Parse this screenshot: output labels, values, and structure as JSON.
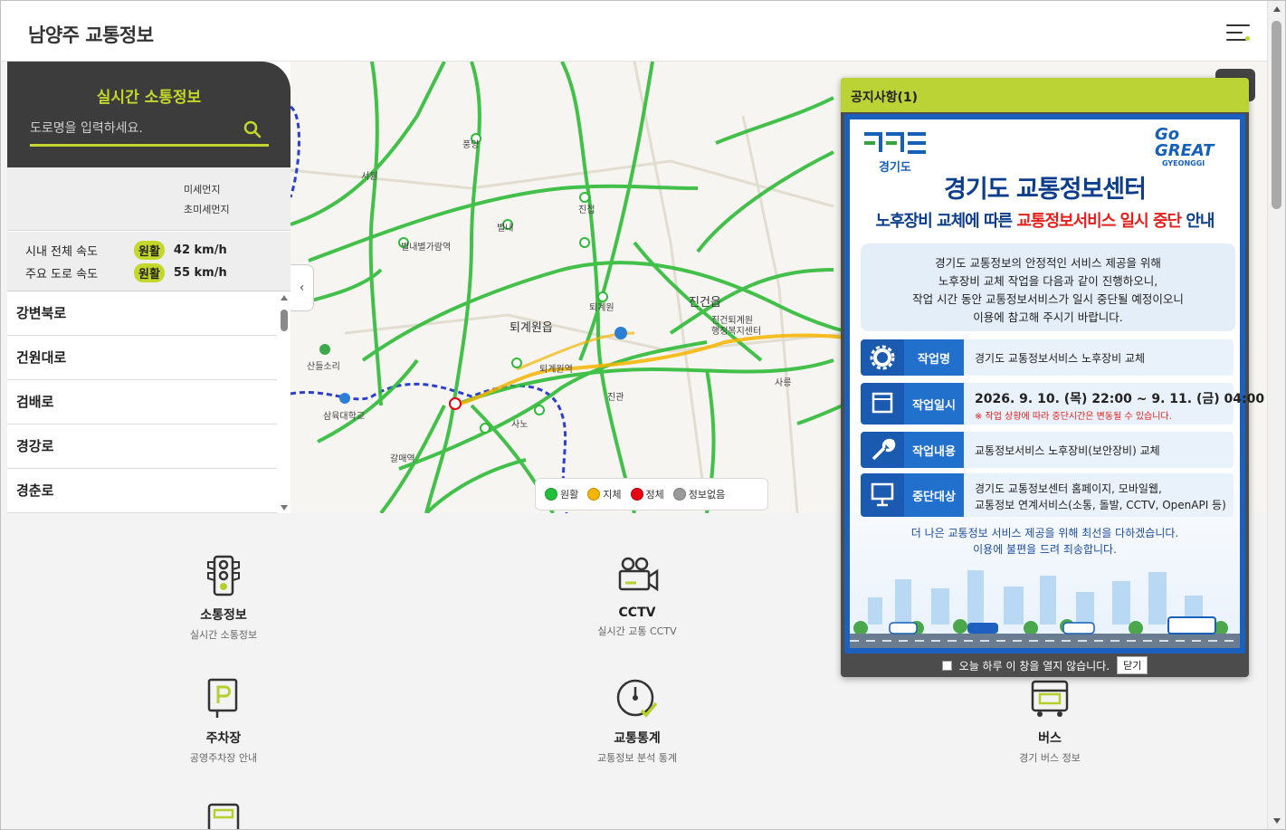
{
  "header": {
    "title": "남양주 교통정보"
  },
  "panel": {
    "title": "실시간 소통정보",
    "search_placeholder": "도로명을 입력하세요.",
    "dust": {
      "pm10": "미세먼지",
      "pm25": "초미세먼지"
    },
    "speeds": [
      {
        "label": "시내 전체 속도",
        "status": "원활",
        "value": "42 km/h"
      },
      {
        "label": "주요 도로 속도",
        "status": "원활",
        "value": "55 km/h"
      }
    ],
    "roads": [
      "강변북로",
      "건원대로",
      "검배로",
      "경강로",
      "경춘로"
    ]
  },
  "map": {
    "labels": [
      "진건읍",
      "퇴계원읍",
      "진건퇴계원\n행정복지센터",
      "산들소리",
      "삼육대학교",
      "별내별가람역",
      "퇴계원역",
      "별내",
      "갈매역",
      "진관",
      "사릉",
      "진접",
      "풍양",
      "서원",
      "사노",
      "퇴계원"
    ],
    "legend": [
      {
        "label": "원활",
        "color": "#22c03a"
      },
      {
        "label": "지체",
        "color": "#f5b400"
      },
      {
        "label": "정체",
        "color": "#e60012"
      },
      {
        "label": "정보없음",
        "color": "#9a9a9a"
      }
    ]
  },
  "services": [
    {
      "name": "소통정보",
      "desc": "실시간 소통정보",
      "icon": "traffic-light-icon"
    },
    {
      "name": "CCTV",
      "desc": "실시간 교통 CCTV",
      "icon": "video-camera-icon"
    },
    {
      "name": "주차장",
      "desc": "공영주차장 안내",
      "icon": "parking-icon"
    },
    {
      "name": "교통통계",
      "desc": "교통정보 분석 통계",
      "icon": "gauge-icon"
    },
    {
      "name": "버스",
      "desc": "경기 버스 정보",
      "icon": "bus-icon"
    }
  ],
  "popup": {
    "title": "공지사항(1)",
    "logo_left": "경기도",
    "logo_right_1": "Go",
    "logo_right_2": "GREAT",
    "logo_right_3": "GYEONGGI",
    "heading": "경기도 교통정보센터",
    "subheading_1": "노후장비 교체에 따른 ",
    "subheading_2": "교통정보서비스 일시 중단",
    "subheading_3": " 안내",
    "intro": [
      "경기도 교통정보의 안정적인 서비스 제공을 위해",
      "노후장비 교체 작업을 다음과 같이 진행하오니,",
      "작업 시간 동안 교통정보서비스가 일시 중단될 예정이오니",
      "이용에 참고해 주시기 바랍니다."
    ],
    "rows": [
      {
        "key": "작업명",
        "value": "경기도 교통정보서비스 노후장비 교체"
      },
      {
        "key": "작업일시",
        "value": "2026. 9. 10. (목) 22:00  ~  9. 11. (금) 04:00",
        "note": "※ 작업 상황에 따라 중단시간은 변동될 수 있습니다."
      },
      {
        "key": "작업내용",
        "value": "교통정보서비스 노후장비(보안장비) 교체"
      },
      {
        "key": "중단대상",
        "value": "경기도 교통정보센터 홈페이지, 모바일웹,",
        "value2": "교통정보 연계서비스(소통, 돌발, CCTV, OpenAPI 등)"
      }
    ],
    "footer_lines": [
      "더 나은 교통정보 서비스 제공을 위해 최선을 다하겠습니다.",
      "이용에 불편을 드려 죄송합니다."
    ],
    "dont_show": "오늘 하루 이 창을 열지 않습니다.",
    "close": "닫기"
  },
  "colors": {
    "accent": "#c3d82b",
    "panel_dark": "#3c3c3c",
    "notice_blue": "#1a61bf"
  }
}
